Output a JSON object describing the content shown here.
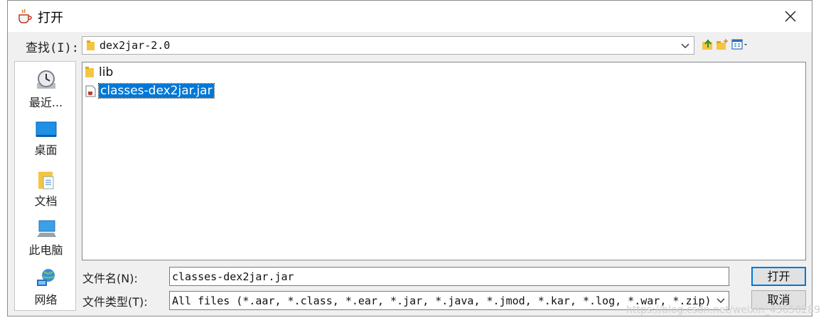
{
  "window": {
    "title": "打开",
    "close_icon": "close-icon",
    "title_icon": "java-cup-icon"
  },
  "lookin": {
    "label": "查找(I):",
    "value": "dex2jar-2.0"
  },
  "toolbar": {
    "icons": [
      "up-folder-icon",
      "new-folder-icon",
      "view-menu-icon"
    ]
  },
  "sidebar": {
    "items": [
      {
        "label": "最近...",
        "icon": "recent-clock-icon"
      },
      {
        "label": "桌面",
        "icon": "desktop-icon"
      },
      {
        "label": "文档",
        "icon": "documents-icon"
      },
      {
        "label": "此电脑",
        "icon": "computer-icon"
      },
      {
        "label": "网络",
        "icon": "network-icon"
      }
    ]
  },
  "files": [
    {
      "name": "lib",
      "icon": "folder-icon",
      "selected": false
    },
    {
      "name": "classes-dex2jar.jar",
      "icon": "jar-file-icon",
      "selected": true
    }
  ],
  "filename": {
    "label": "文件名(N):",
    "value": "classes-dex2jar.jar"
  },
  "filetype": {
    "label": "文件类型(T):",
    "value": "All files (*.aar, *.class, *.ear, *.jar, *.java, *.jmod, *.kar, *.log, *.war, *.zip)"
  },
  "buttons": {
    "open": "打开",
    "cancel": "取消"
  },
  "watermark": "https://blog.csdn.net/weixin_43650289",
  "colors": {
    "selection": "#0078d7",
    "dialog_bg": "#f0f0f0"
  }
}
